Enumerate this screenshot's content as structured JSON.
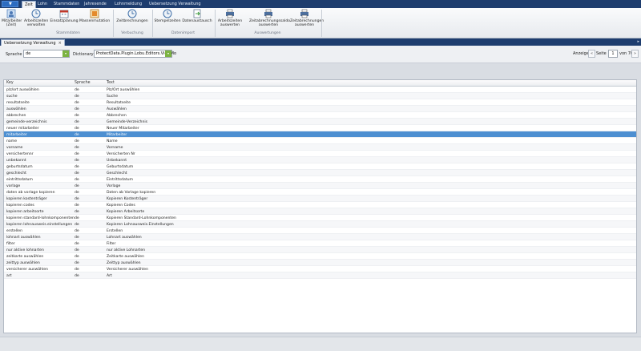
{
  "app_button": "▼",
  "tabs": [
    "Zeit",
    "Lohn",
    "Stammdaten",
    "Jahresende",
    "Lohnmeldung",
    "Uebersetzung Verwaltung"
  ],
  "ribbon": {
    "buttons": [
      {
        "label": "Mitarbeiter\n(Zeit)",
        "icon": "employee-icon"
      },
      {
        "label": "Arbeitszeiten\nverwalten",
        "icon": "clock-icon"
      },
      {
        "label": "Einsatzplanung",
        "icon": "calendar-icon"
      },
      {
        "label": "Massenmutation",
        "icon": "mass-mutation-icon"
      },
      {
        "label": "Zeitbrechnungen",
        "icon": "clock-icon"
      },
      {
        "label": "Stempelzeiten",
        "icon": "clock-icon"
      },
      {
        "label": "Datenaustausch",
        "icon": "data-exchange-icon"
      },
      {
        "label": "Arbeitszeiten\nauswerten",
        "icon": "printer-icon"
      },
      {
        "label": "Zeitabrechnungssaldo\nauswerten",
        "icon": "printer-icon"
      },
      {
        "label": "Zeitabrechnungen\nauswerten",
        "icon": "printer-icon"
      }
    ],
    "groups": [
      "Stammdaten",
      "Verbuchung",
      "Datenimport",
      "Auswertungen"
    ]
  },
  "doc_tab": {
    "label": "Uebersetzung Verwaltung",
    "close": "×"
  },
  "strip_arrow": "▸",
  "filter": {
    "sprache_label": "Sprache",
    "sprache_value": "de",
    "dictionary_label": "Dictionary",
    "dictionary_value": "ProtectData.Plugin.Lobu.Editors.ViewMo",
    "dropdown_glyph": "▾"
  },
  "pager": {
    "anzeige": "Anzeige",
    "prev": "«",
    "page_label": "Seite",
    "page": "1",
    "of": "von 70",
    "next": "»"
  },
  "grid": {
    "headers": [
      "Key",
      "Sprache",
      "Text"
    ],
    "rows": [
      [
        "plz/ort auswählen",
        "de",
        "Plz/Ort auswählen"
      ],
      [
        "suche",
        "de",
        "Suche"
      ],
      [
        "resultatseite",
        "de",
        "Resultatseite"
      ],
      [
        "auswählen",
        "de",
        "Auswählen"
      ],
      [
        "abbrechen",
        "de",
        "Abbrechen"
      ],
      [
        "gemeinde-verzeichnis",
        "de",
        "Gemeinde-Verzeichnis"
      ],
      [
        "neuer mitarbeiter",
        "de",
        "Neuer Mitarbeiter"
      ],
      [
        "mitarbeiter",
        "de",
        "Mitarbeiter"
      ],
      [
        "name",
        "de",
        "Name"
      ],
      [
        "vorname",
        "de",
        "Vorname"
      ],
      [
        "versichertennr",
        "de",
        "Versicherten Nr"
      ],
      [
        "unbekannt",
        "de",
        "Unbekannt"
      ],
      [
        "geburtsdatum",
        "de",
        "Geburtsdatum"
      ],
      [
        "geschlecht",
        "de",
        "Geschlecht"
      ],
      [
        "eintrittsdatum",
        "de",
        "Eintrittsdatum"
      ],
      [
        "vorlage",
        "de",
        "Vorlage"
      ],
      [
        "daten ab vorlage kopieren",
        "de",
        "Daten ab Vorlage kopieren"
      ],
      [
        "kopieren kostenträger",
        "de",
        "Kopieren Kostenträger"
      ],
      [
        "kopieren codes",
        "de",
        "Kopieren Codes"
      ],
      [
        "kopieren arbeitsorte",
        "de",
        "Kopieren Arbeitsorte"
      ],
      [
        "kopieren standard-lohnkomponenten",
        "de",
        "Kopieren Standard-Lohnkomponenten"
      ],
      [
        "kopieren lohnausweis.einstellungen",
        "de",
        "Kopieren Lohnausweis.Einstellungen"
      ],
      [
        "erstellen",
        "de",
        "Erstellen"
      ],
      [
        "lohnart auswählen",
        "de",
        "Lohnart auswählen"
      ],
      [
        "filter",
        "de",
        "Filter"
      ],
      [
        "nur aktive lohnarten",
        "de",
        "nur aktive Lohnarten"
      ],
      [
        "zeitkarte auswählen",
        "de",
        "Zeitkarte auswählen"
      ],
      [
        "zeittyp auswählen",
        "de",
        "Zeittyp auswählen"
      ],
      [
        "versicherer auswählen",
        "de",
        "Versicherer auswählen"
      ],
      [
        "art",
        "de",
        "Art"
      ]
    ],
    "selected_index": 7
  }
}
